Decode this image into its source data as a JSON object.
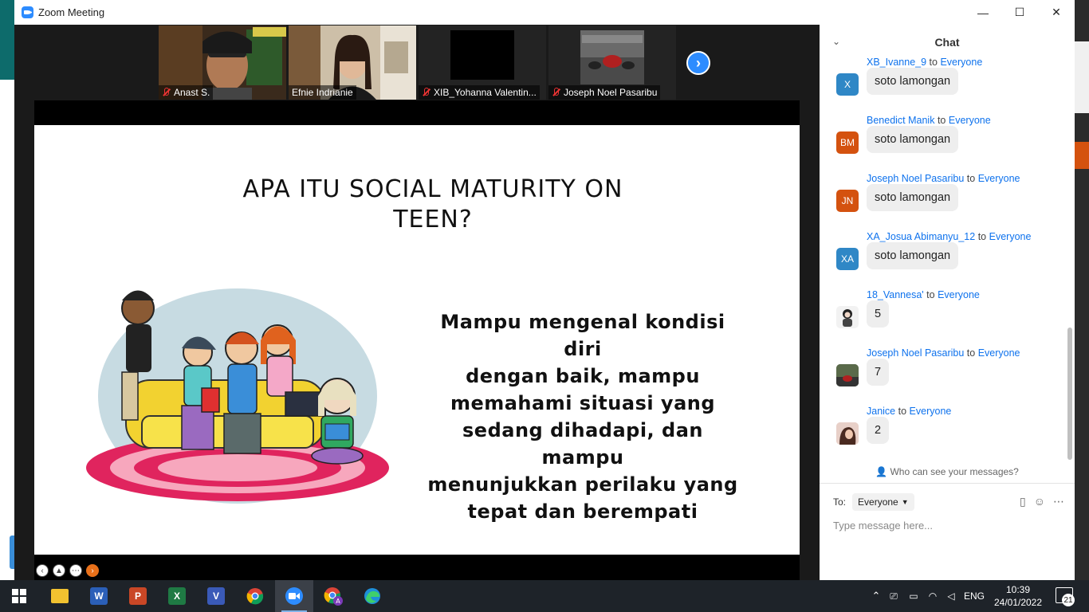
{
  "window": {
    "title": "Zoom Meeting",
    "minimize": "—",
    "maximize": "☐",
    "close": "✕"
  },
  "participants": [
    {
      "name": "Anast S.",
      "muted": true
    },
    {
      "name": "Efnie Indrianie",
      "muted": false,
      "active": true
    },
    {
      "name": "XIB_Yohanna Valentin...",
      "muted": true
    },
    {
      "name": "Joseph Noel Pasaribu",
      "muted": true
    }
  ],
  "participant_nav": "›",
  "slide": {
    "title_line1": "APA ITU SOCIAL MATURITY ON",
    "title_line2": "TEEN?",
    "body_lines": [
      "Mampu mengenal kondisi diri",
      "dengan baik, mampu",
      "memahami situasi yang",
      "sedang dihadapi, dan mampu",
      "menunjukkan perilaku yang",
      "tepat dan berempati"
    ]
  },
  "share_tools": [
    "back-icon",
    "pen-icon",
    "more-icon",
    "forward-icon"
  ],
  "chat": {
    "header": "Chat",
    "collapse": "⌄",
    "messages": [
      {
        "sender": "XB_Ivanne_9",
        "to": "to",
        "recipient": "Everyone",
        "initials": "X",
        "avatar_color": "#2f87c6",
        "text": "soto lamongan"
      },
      {
        "sender": "Benedict Manik",
        "to": "to",
        "recipient": "Everyone",
        "initials": "BM",
        "avatar_color": "#d4520f",
        "text": "soto lamongan"
      },
      {
        "sender": "Joseph Noel Pasaribu",
        "to": "to",
        "recipient": "Everyone",
        "initials": "JN",
        "avatar_color": "#d4520f",
        "text": "soto lamongan"
      },
      {
        "sender": "XA_Josua Abimanyu_12",
        "to": "to",
        "recipient": "Everyone",
        "initials": "XA",
        "avatar_color": "#2f87c6",
        "text": "soto lamongan"
      },
      {
        "sender": "18_Vannesa'",
        "to": "to",
        "recipient": "Everyone",
        "initials": "",
        "avatar_color": "#e8e8e8",
        "text": "5"
      },
      {
        "sender": "Joseph Noel Pasaribu",
        "to": "to",
        "recipient": "Everyone",
        "initials": "",
        "avatar_color": "#4a5a3a",
        "text": "7"
      },
      {
        "sender": "Janice",
        "to": "to",
        "recipient": "Everyone",
        "initials": "",
        "avatar_color": "#c89080",
        "text": "2"
      }
    ],
    "who_can_see": "Who can see your messages?",
    "to_label": "To:",
    "to_value": "Everyone",
    "input_placeholder": "Type message here..."
  },
  "taskbar": {
    "apps": [
      {
        "name": "windows-start",
        "label": ""
      },
      {
        "name": "file-explorer",
        "label": ""
      },
      {
        "name": "word",
        "label": "W"
      },
      {
        "name": "powerpoint",
        "label": "P"
      },
      {
        "name": "excel",
        "label": "X"
      },
      {
        "name": "visio",
        "label": "V"
      },
      {
        "name": "chrome",
        "label": ""
      },
      {
        "name": "zoom",
        "label": ""
      },
      {
        "name": "chrome-profile",
        "label": "A"
      },
      {
        "name": "edge",
        "label": ""
      }
    ],
    "language": "ENG",
    "time": "10:39",
    "date": "24/01/2022",
    "notifications": "21"
  },
  "colors": {
    "accent": "#2d8cff",
    "link": "#0e72ed",
    "taskbar": "#1e2329"
  }
}
